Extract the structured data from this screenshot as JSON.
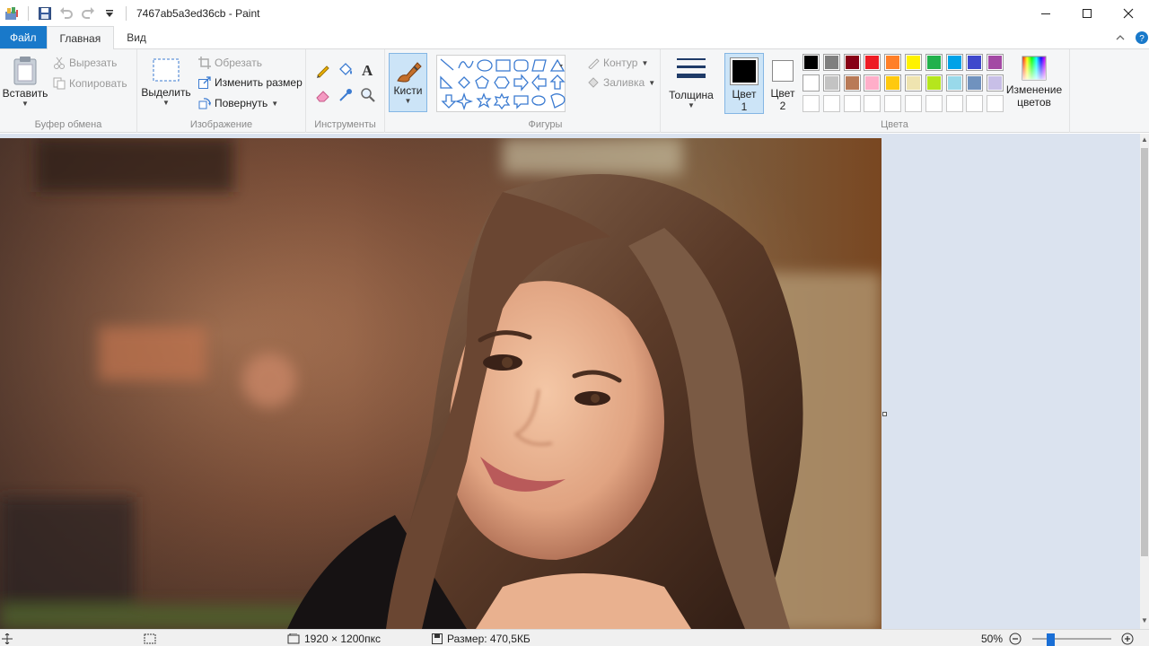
{
  "window": {
    "title": "7467ab5a3ed36cb - Paint"
  },
  "tabs": {
    "file": "Файл",
    "home": "Главная",
    "view": "Вид"
  },
  "clipboard": {
    "paste": "Вставить",
    "cut": "Вырезать",
    "copy": "Копировать",
    "label": "Буфер обмена"
  },
  "image": {
    "select": "Выделить",
    "crop": "Обрезать",
    "resize": "Изменить размер",
    "rotate": "Повернуть",
    "label": "Изображение"
  },
  "tools": {
    "label": "Инструменты"
  },
  "brushes": {
    "label": "Кисти"
  },
  "shapes": {
    "outline": "Контур",
    "fill": "Заливка",
    "label": "Фигуры"
  },
  "size": {
    "label": "Толщина"
  },
  "colors": {
    "color1_a": "Цвет",
    "color1_b": "1",
    "color2_a": "Цвет",
    "color2_b": "2",
    "edit_a": "Изменение",
    "edit_b": "цветов",
    "label": "Цвета",
    "color1_value": "#000000",
    "color2_value": "#ffffff",
    "palette_row1": [
      "#000000",
      "#7f7f7f",
      "#880015",
      "#ed1c24",
      "#ff7f27",
      "#fff200",
      "#22b14c",
      "#00a2e8",
      "#3f48cc",
      "#a349a4"
    ],
    "palette_row2": [
      "#ffffff",
      "#c3c3c3",
      "#b97a57",
      "#ffaec9",
      "#ffc90e",
      "#efe4b0",
      "#b5e61d",
      "#99d9ea",
      "#7092be",
      "#c8bfe7"
    ],
    "palette_row3": [
      "",
      "",
      "",
      "",
      "",
      "",
      "",
      "",
      "",
      ""
    ]
  },
  "status": {
    "dimensions": "1920 × 1200пкс",
    "filesize": "Размер: 470,5КБ",
    "zoom": "50%"
  }
}
